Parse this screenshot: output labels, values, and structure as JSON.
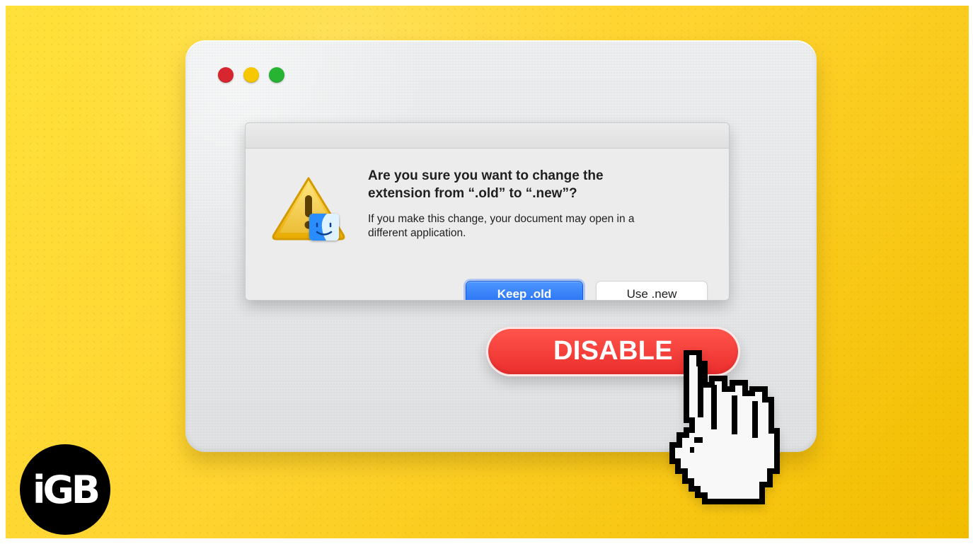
{
  "dialog": {
    "title": "Are you sure you want to change the\nextension from “.old” to “.new”?",
    "message": "If you make this change, your document may open in a\ndifferent application.",
    "keep_label": "Keep .old",
    "use_label": "Use .new"
  },
  "action_button": {
    "label": "DISABLE"
  },
  "branding": {
    "logo_text": "iGB"
  },
  "icons": {
    "window_controls": [
      "close-icon",
      "minimize-icon",
      "zoom-icon"
    ],
    "warning": "warning-icon",
    "finder": "finder-icon",
    "pointer": "hand-cursor-icon"
  },
  "colors": {
    "background": "#ffd430",
    "window": "#e4e6e8",
    "dialog": "#ececec",
    "primary_button": "#236cf2",
    "disable_button": "#eb2e2d",
    "close": "#d7262f",
    "minimize": "#f7c800",
    "zoom": "#28b433",
    "logo": "#000000"
  }
}
